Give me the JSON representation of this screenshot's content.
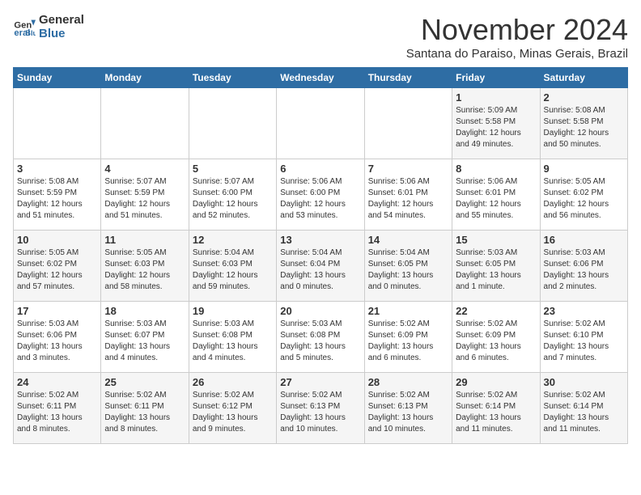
{
  "logo": {
    "line1": "General",
    "line2": "Blue"
  },
  "title": "November 2024",
  "subtitle": "Santana do Paraiso, Minas Gerais, Brazil",
  "days_header": [
    "Sunday",
    "Monday",
    "Tuesday",
    "Wednesday",
    "Thursday",
    "Friday",
    "Saturday"
  ],
  "weeks": [
    [
      {
        "day": "",
        "info": ""
      },
      {
        "day": "",
        "info": ""
      },
      {
        "day": "",
        "info": ""
      },
      {
        "day": "",
        "info": ""
      },
      {
        "day": "",
        "info": ""
      },
      {
        "day": "1",
        "info": "Sunrise: 5:09 AM\nSunset: 5:58 PM\nDaylight: 12 hours\nand 49 minutes."
      },
      {
        "day": "2",
        "info": "Sunrise: 5:08 AM\nSunset: 5:58 PM\nDaylight: 12 hours\nand 50 minutes."
      }
    ],
    [
      {
        "day": "3",
        "info": "Sunrise: 5:08 AM\nSunset: 5:59 PM\nDaylight: 12 hours\nand 51 minutes."
      },
      {
        "day": "4",
        "info": "Sunrise: 5:07 AM\nSunset: 5:59 PM\nDaylight: 12 hours\nand 51 minutes."
      },
      {
        "day": "5",
        "info": "Sunrise: 5:07 AM\nSunset: 6:00 PM\nDaylight: 12 hours\nand 52 minutes."
      },
      {
        "day": "6",
        "info": "Sunrise: 5:06 AM\nSunset: 6:00 PM\nDaylight: 12 hours\nand 53 minutes."
      },
      {
        "day": "7",
        "info": "Sunrise: 5:06 AM\nSunset: 6:01 PM\nDaylight: 12 hours\nand 54 minutes."
      },
      {
        "day": "8",
        "info": "Sunrise: 5:06 AM\nSunset: 6:01 PM\nDaylight: 12 hours\nand 55 minutes."
      },
      {
        "day": "9",
        "info": "Sunrise: 5:05 AM\nSunset: 6:02 PM\nDaylight: 12 hours\nand 56 minutes."
      }
    ],
    [
      {
        "day": "10",
        "info": "Sunrise: 5:05 AM\nSunset: 6:02 PM\nDaylight: 12 hours\nand 57 minutes."
      },
      {
        "day": "11",
        "info": "Sunrise: 5:05 AM\nSunset: 6:03 PM\nDaylight: 12 hours\nand 58 minutes."
      },
      {
        "day": "12",
        "info": "Sunrise: 5:04 AM\nSunset: 6:03 PM\nDaylight: 12 hours\nand 59 minutes."
      },
      {
        "day": "13",
        "info": "Sunrise: 5:04 AM\nSunset: 6:04 PM\nDaylight: 13 hours\nand 0 minutes."
      },
      {
        "day": "14",
        "info": "Sunrise: 5:04 AM\nSunset: 6:05 PM\nDaylight: 13 hours\nand 0 minutes."
      },
      {
        "day": "15",
        "info": "Sunrise: 5:03 AM\nSunset: 6:05 PM\nDaylight: 13 hours\nand 1 minute."
      },
      {
        "day": "16",
        "info": "Sunrise: 5:03 AM\nSunset: 6:06 PM\nDaylight: 13 hours\nand 2 minutes."
      }
    ],
    [
      {
        "day": "17",
        "info": "Sunrise: 5:03 AM\nSunset: 6:06 PM\nDaylight: 13 hours\nand 3 minutes."
      },
      {
        "day": "18",
        "info": "Sunrise: 5:03 AM\nSunset: 6:07 PM\nDaylight: 13 hours\nand 4 minutes."
      },
      {
        "day": "19",
        "info": "Sunrise: 5:03 AM\nSunset: 6:08 PM\nDaylight: 13 hours\nand 4 minutes."
      },
      {
        "day": "20",
        "info": "Sunrise: 5:03 AM\nSunset: 6:08 PM\nDaylight: 13 hours\nand 5 minutes."
      },
      {
        "day": "21",
        "info": "Sunrise: 5:02 AM\nSunset: 6:09 PM\nDaylight: 13 hours\nand 6 minutes."
      },
      {
        "day": "22",
        "info": "Sunrise: 5:02 AM\nSunset: 6:09 PM\nDaylight: 13 hours\nand 6 minutes."
      },
      {
        "day": "23",
        "info": "Sunrise: 5:02 AM\nSunset: 6:10 PM\nDaylight: 13 hours\nand 7 minutes."
      }
    ],
    [
      {
        "day": "24",
        "info": "Sunrise: 5:02 AM\nSunset: 6:11 PM\nDaylight: 13 hours\nand 8 minutes."
      },
      {
        "day": "25",
        "info": "Sunrise: 5:02 AM\nSunset: 6:11 PM\nDaylight: 13 hours\nand 8 minutes."
      },
      {
        "day": "26",
        "info": "Sunrise: 5:02 AM\nSunset: 6:12 PM\nDaylight: 13 hours\nand 9 minutes."
      },
      {
        "day": "27",
        "info": "Sunrise: 5:02 AM\nSunset: 6:13 PM\nDaylight: 13 hours\nand 10 minutes."
      },
      {
        "day": "28",
        "info": "Sunrise: 5:02 AM\nSunset: 6:13 PM\nDaylight: 13 hours\nand 10 minutes."
      },
      {
        "day": "29",
        "info": "Sunrise: 5:02 AM\nSunset: 6:14 PM\nDaylight: 13 hours\nand 11 minutes."
      },
      {
        "day": "30",
        "info": "Sunrise: 5:02 AM\nSunset: 6:14 PM\nDaylight: 13 hours\nand 11 minutes."
      }
    ]
  ]
}
